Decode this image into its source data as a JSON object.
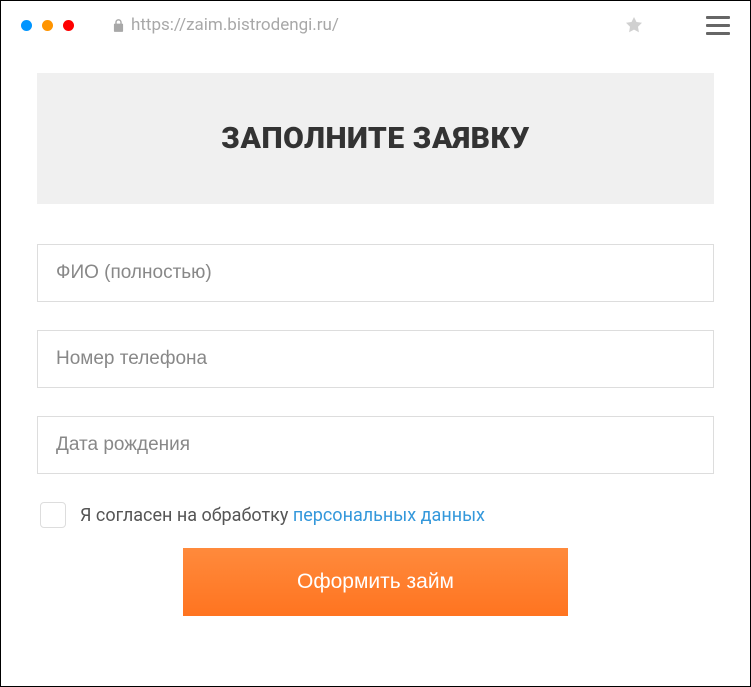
{
  "browser": {
    "url": "https://zaim.bistrodengi.ru/"
  },
  "header": {
    "title": "ЗАПОЛНИТЕ ЗАЯВКУ"
  },
  "form": {
    "fullname_placeholder": "ФИО (полностью)",
    "phone_placeholder": "Номер телефона",
    "birthdate_placeholder": "Дата рождения",
    "consent_text": "Я согласен на обработку ",
    "consent_link": "персональных данных",
    "submit_label": "Оформить займ"
  }
}
